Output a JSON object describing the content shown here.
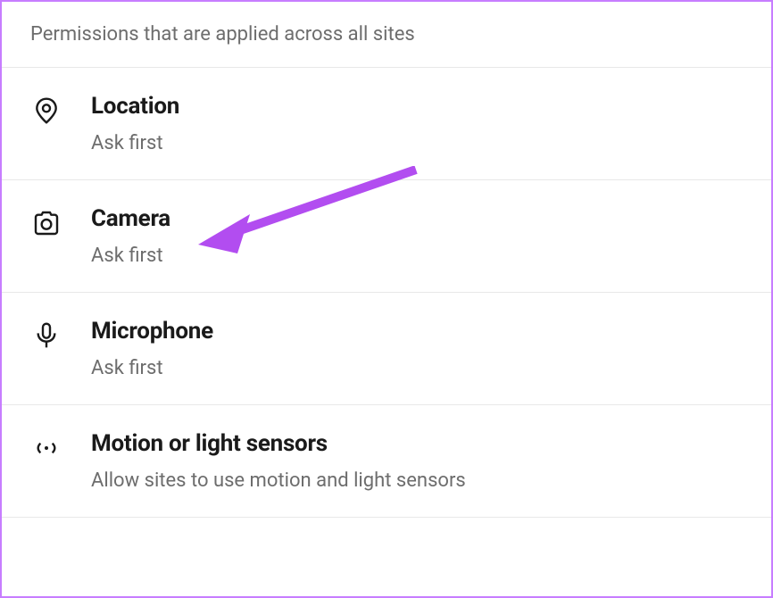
{
  "header": {
    "description": "Permissions that are applied across all sites"
  },
  "permissions": [
    {
      "icon": "location-icon",
      "title": "Location",
      "subtitle": "Ask first"
    },
    {
      "icon": "camera-icon",
      "title": "Camera",
      "subtitle": "Ask first"
    },
    {
      "icon": "microphone-icon",
      "title": "Microphone",
      "subtitle": "Ask first"
    },
    {
      "icon": "motion-sensors-icon",
      "title": "Motion or light sensors",
      "subtitle": "Allow sites to use motion and light sensors"
    }
  ],
  "annotation": {
    "arrow_color": "#b24df0",
    "points_to": "Camera"
  }
}
